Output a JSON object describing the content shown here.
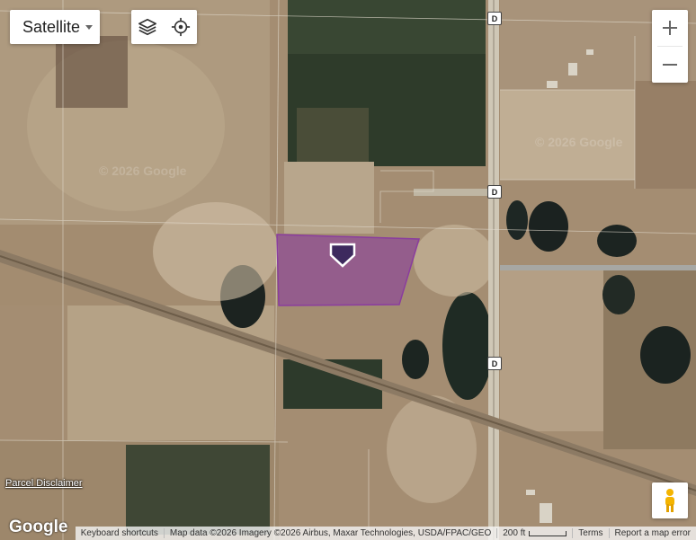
{
  "map": {
    "type_selector": {
      "label": "Satellite"
    },
    "tools": {
      "layers_icon": "layers-icon",
      "locate_icon": "crosshair-icon"
    },
    "zoom": {
      "in_label": "+",
      "out_label": "−"
    },
    "road_labels": [
      "D",
      "D",
      "D"
    ],
    "watermarks": [
      "© 2026 Google",
      "© 2026 Google"
    ],
    "parcel_color": "#8a3d9e",
    "marker_color": "#3d2a5e"
  },
  "overlay": {
    "disclaimer": "Parcel Disclaimer",
    "logo": "Google"
  },
  "footer": {
    "keyboard": "Keyboard shortcuts",
    "attribution": "Map data ©2026 Imagery ©2026 Airbus, Maxar Technologies, USDA/FPAC/GEO",
    "scale": "200 ft",
    "terms": "Terms",
    "report": "Report a map error"
  }
}
